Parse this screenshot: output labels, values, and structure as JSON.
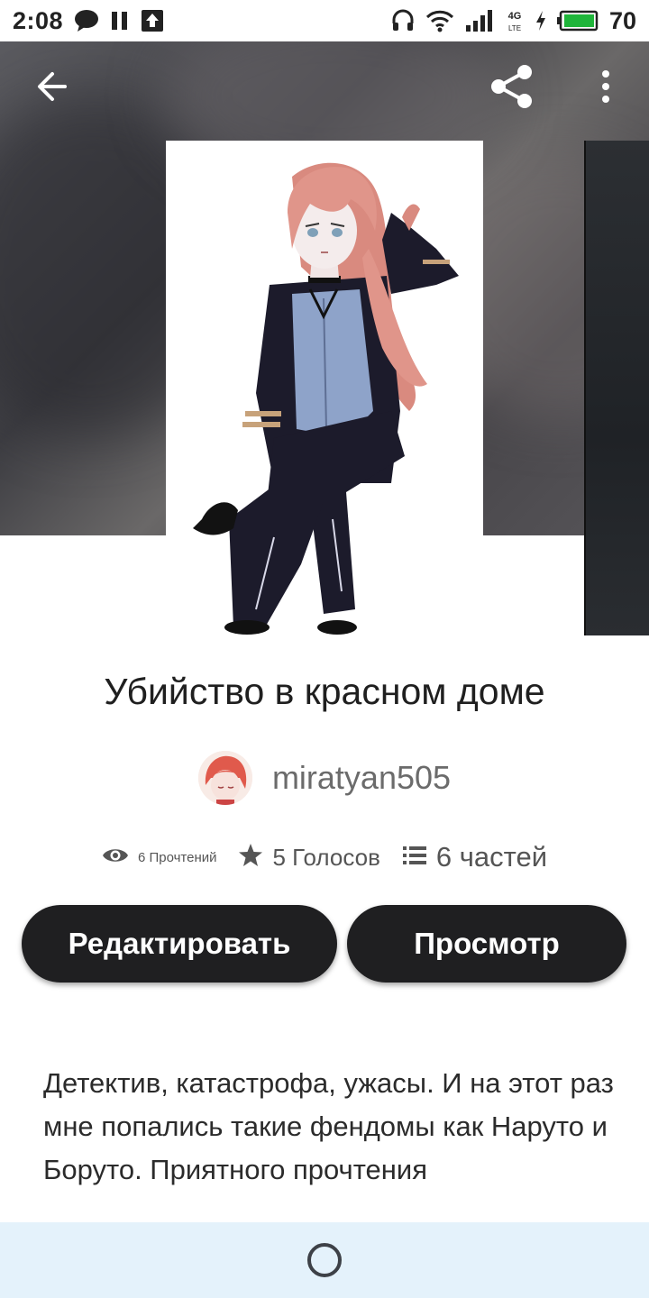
{
  "status_bar": {
    "time": "2:08",
    "battery_level": "70",
    "network_label": "4G"
  },
  "story": {
    "title": "Убийство в красном доме",
    "author": "miratyan505",
    "reads_label": "6 Прочтений",
    "votes_label": "5 Голосов",
    "parts_label": "6 частей",
    "description": "Детектив, катастрофа, ужасы. И на этот раз мне попались такие фендомы как Наруто и Боруто. Приятного прочтения"
  },
  "actions": {
    "edit_label": "Редактировать",
    "view_label": "Просмотр"
  },
  "colors": {
    "button_bg": "#1f1f21",
    "navbar_bg": "#e4f2fb",
    "title_text": "#1f1f1f"
  },
  "icons": {
    "back": "arrow-back-icon",
    "share": "share-icon",
    "more": "more-vertical-icon",
    "reads": "eye-icon",
    "votes": "star-icon",
    "parts": "list-icon",
    "home": "home-circle-icon"
  }
}
